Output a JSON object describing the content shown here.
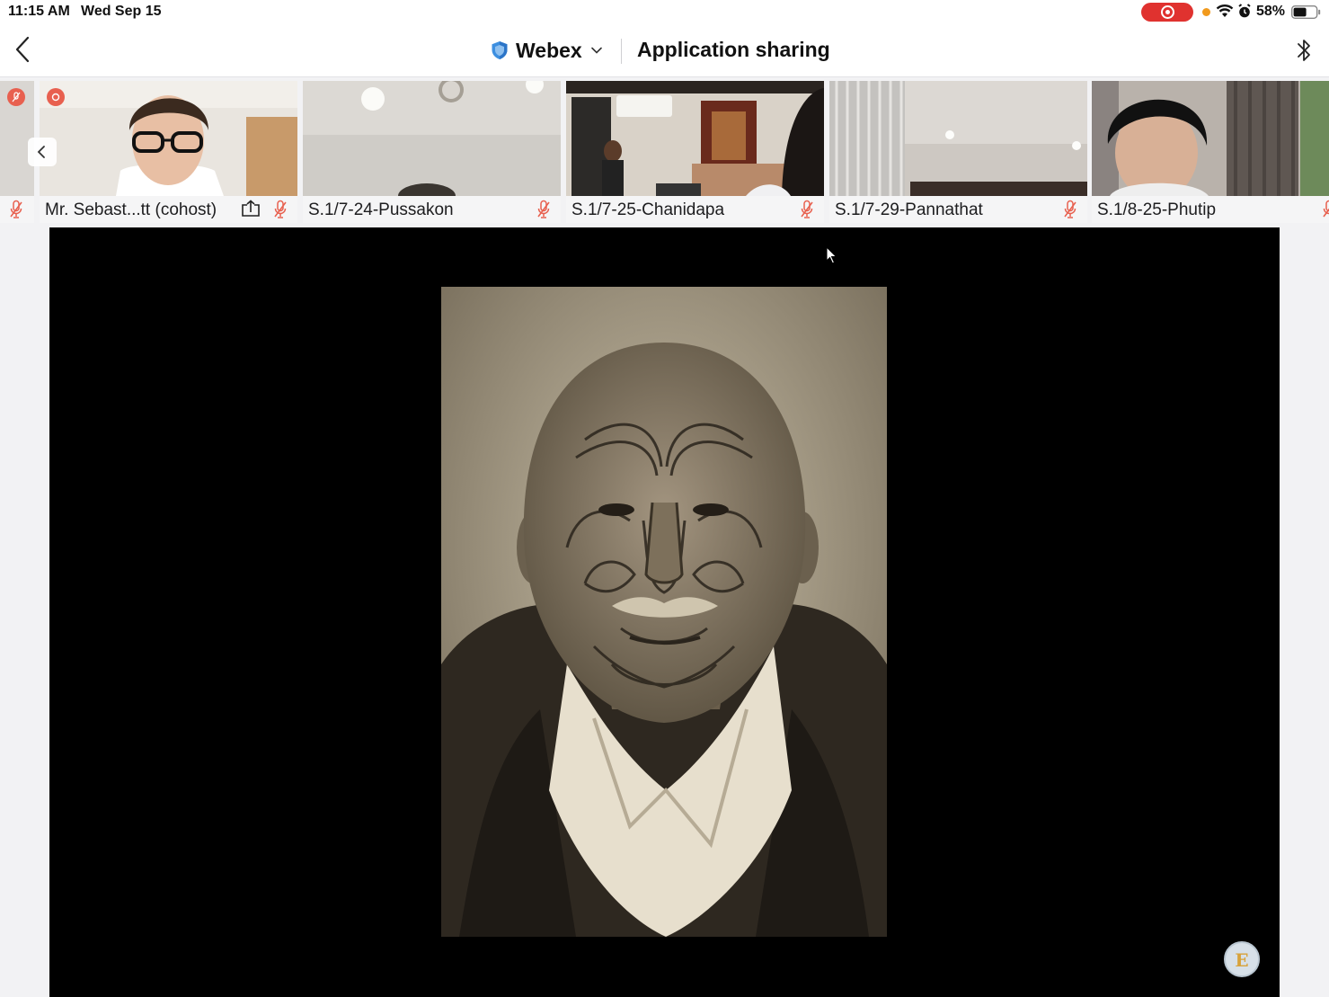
{
  "status_bar": {
    "time": "11:15 AM",
    "date": "Wed Sep 15",
    "battery_percent": "58%",
    "battery_level": 0.58,
    "recording_icon": "screen-record-icon",
    "wifi_icon": "wifi-icon",
    "alarm_icon": "alarm-icon"
  },
  "header": {
    "back_icon": "chevron-left-icon",
    "app_name": "Webex",
    "title": "Application sharing",
    "shield_icon": "shield-icon",
    "menu_icon": "chevron-down-icon",
    "right_icon": "bluetooth-icon"
  },
  "participants": [
    {
      "name": "Mr. Sebast...tt (cohost)",
      "muted": true,
      "sharing": true
    },
    {
      "name": "S.1/7-24-Pussakon",
      "muted": true,
      "sharing": false
    },
    {
      "name": "S.1/7-25-Chanidapa",
      "muted": true,
      "sharing": false
    },
    {
      "name": "S.1/7-29-Pannathat",
      "muted": true,
      "sharing": false
    },
    {
      "name": "S.1/8-25-Phutip",
      "muted": true,
      "sharing": false
    }
  ],
  "strip": {
    "scroll_left_icon": "chevron-left-icon",
    "mic_off_icon": "mic-off-icon",
    "recording_badge_icon": "record-icon"
  },
  "shared_content": {
    "image": "portrait-photo",
    "cursor_icon": "pointer-cursor-icon",
    "annotation_button_label": "E"
  },
  "colors": {
    "accent_red": "#e0322f",
    "mute_red": "#e8604f",
    "shield_blue": "#3d8fe0"
  }
}
